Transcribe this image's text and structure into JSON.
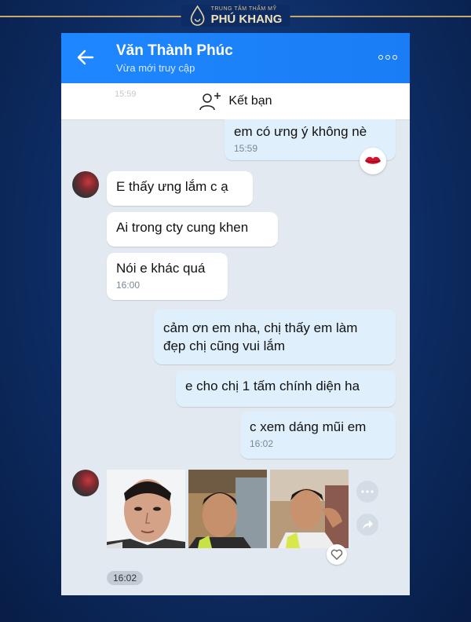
{
  "brand": {
    "small_text": "TRUNG TÂM THẨM MỸ",
    "name": "PHÚ KHANG"
  },
  "header": {
    "contact_name": "Văn Thành Phúc",
    "status": "Vừa mới truy cập"
  },
  "add_friend": {
    "label": "Kết bạn",
    "ghost_time": "15:59"
  },
  "messages": [
    {
      "dir": "out",
      "text": "em có ưng ý không nè",
      "time": "15:59"
    },
    {
      "dir": "in",
      "text": "E thấy ưng lắm c ạ"
    },
    {
      "dir": "in",
      "text": "Ai trong cty cung khen"
    },
    {
      "dir": "in",
      "text": "Nói e khác quá",
      "time": "16:00"
    },
    {
      "dir": "out",
      "line1": "cảm ơn em nha, chị thấy em làm",
      "line2": "đẹp chị cũng vui lắm"
    },
    {
      "dir": "out",
      "text": "e cho chị 1 tấm chính diện ha"
    },
    {
      "dir": "out",
      "text": "c xem dáng mũi em",
      "time": "16:02"
    }
  ],
  "photo_time": "16:02",
  "colors": {
    "accent": "#1a7df5",
    "outgoing": "#dff0fc",
    "gold": "#c9a96b"
  }
}
